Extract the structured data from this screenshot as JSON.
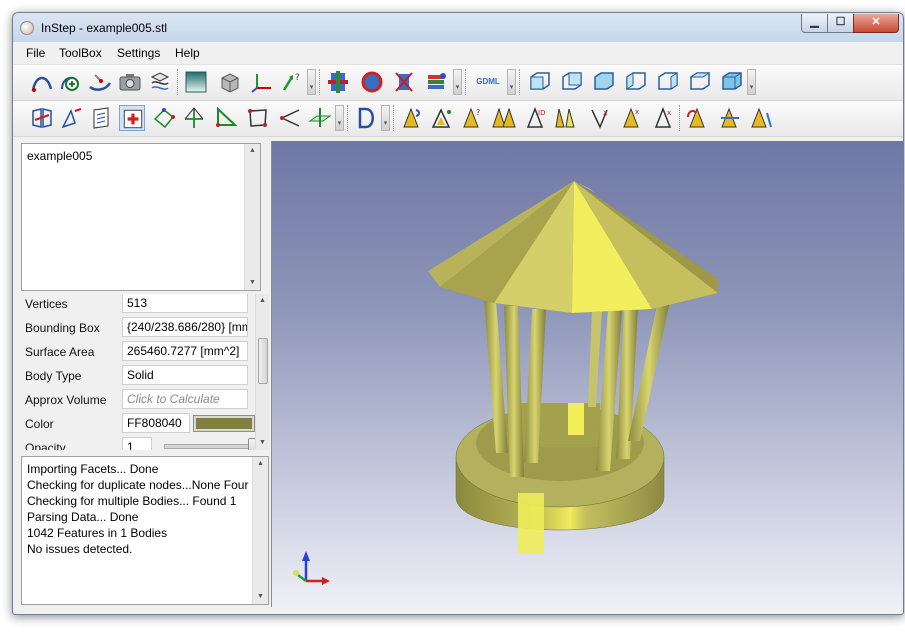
{
  "window": {
    "app_name": "InStep",
    "title_separator": " - ",
    "file_name": "example005.stl",
    "minimize_glyph": "▁",
    "maximize_glyph": "☐",
    "close_glyph": "✕"
  },
  "menu": {
    "items": [
      "File",
      "ToolBox",
      "Settings",
      "Help"
    ]
  },
  "toolbar": {
    "gdml_label": "GDML"
  },
  "tree": {
    "root_item": "example005"
  },
  "properties": {
    "vertices_label": "Vertices",
    "vertices_value": "513",
    "bbox_label": "Bounding Box",
    "bbox_value": "{240/238.686/280} [mm",
    "surface_label": "Surface Area",
    "surface_value": "265460.7277 [mm^2]",
    "body_type_label": "Body Type",
    "body_type_value": "Solid",
    "volume_label": "Approx Volume",
    "volume_placeholder": "Click to Calculate",
    "color_label": "Color",
    "color_value": "FF808040",
    "opacity_label": "Opacity",
    "opacity_value": "1"
  },
  "log": {
    "lines": [
      "Importing Facets... Done",
      "Checking for duplicate nodes...None Four",
      "Checking for multiple Bodies... Found 1",
      "Parsing Data... Done",
      "1042 Features in 1 Bodies",
      "No issues detected."
    ]
  },
  "colors": {
    "model_color": "#808040",
    "viewport_top": "#6f77a6",
    "viewport_bottom": "#eeeff6",
    "accent": "#3a6cc4"
  },
  "icons": {
    "toolbar_row1": [
      "curve-tool-icon",
      "add-sphere-icon",
      "surface-tool-icon",
      "camera-icon",
      "transform-icon",
      "gradient-box-icon",
      "box-solid-icon",
      "axes-icon",
      "help-arrow-icon",
      "slice-icon",
      "sphere-red-icon",
      "clip-icon",
      "layers-icon",
      "gdml-icon",
      "cube-front-icon",
      "cube-back-icon",
      "cube-left-icon",
      "cube-right-icon",
      "cube-top-icon",
      "cube-bottom-icon",
      "cube-iso-icon"
    ],
    "toolbar_row2": [
      "book-tool-icon",
      "pen-arrow-icon",
      "page-tool-icon",
      "first-aid-icon",
      "scatter-icon",
      "arrow-triangle-icon",
      "triangle-icon",
      "square-points-icon",
      "angle-points-icon",
      "plane-icon",
      "d-shape-icon",
      "cone-a-icon",
      "cone-b-icon",
      "cone-c-icon",
      "cone-d-icon",
      "cone-e-icon",
      "cone-f-icon",
      "cone-g-icon",
      "cone-h-icon",
      "cone-i-icon",
      "cone-j-icon",
      "cone-k-icon"
    ]
  }
}
